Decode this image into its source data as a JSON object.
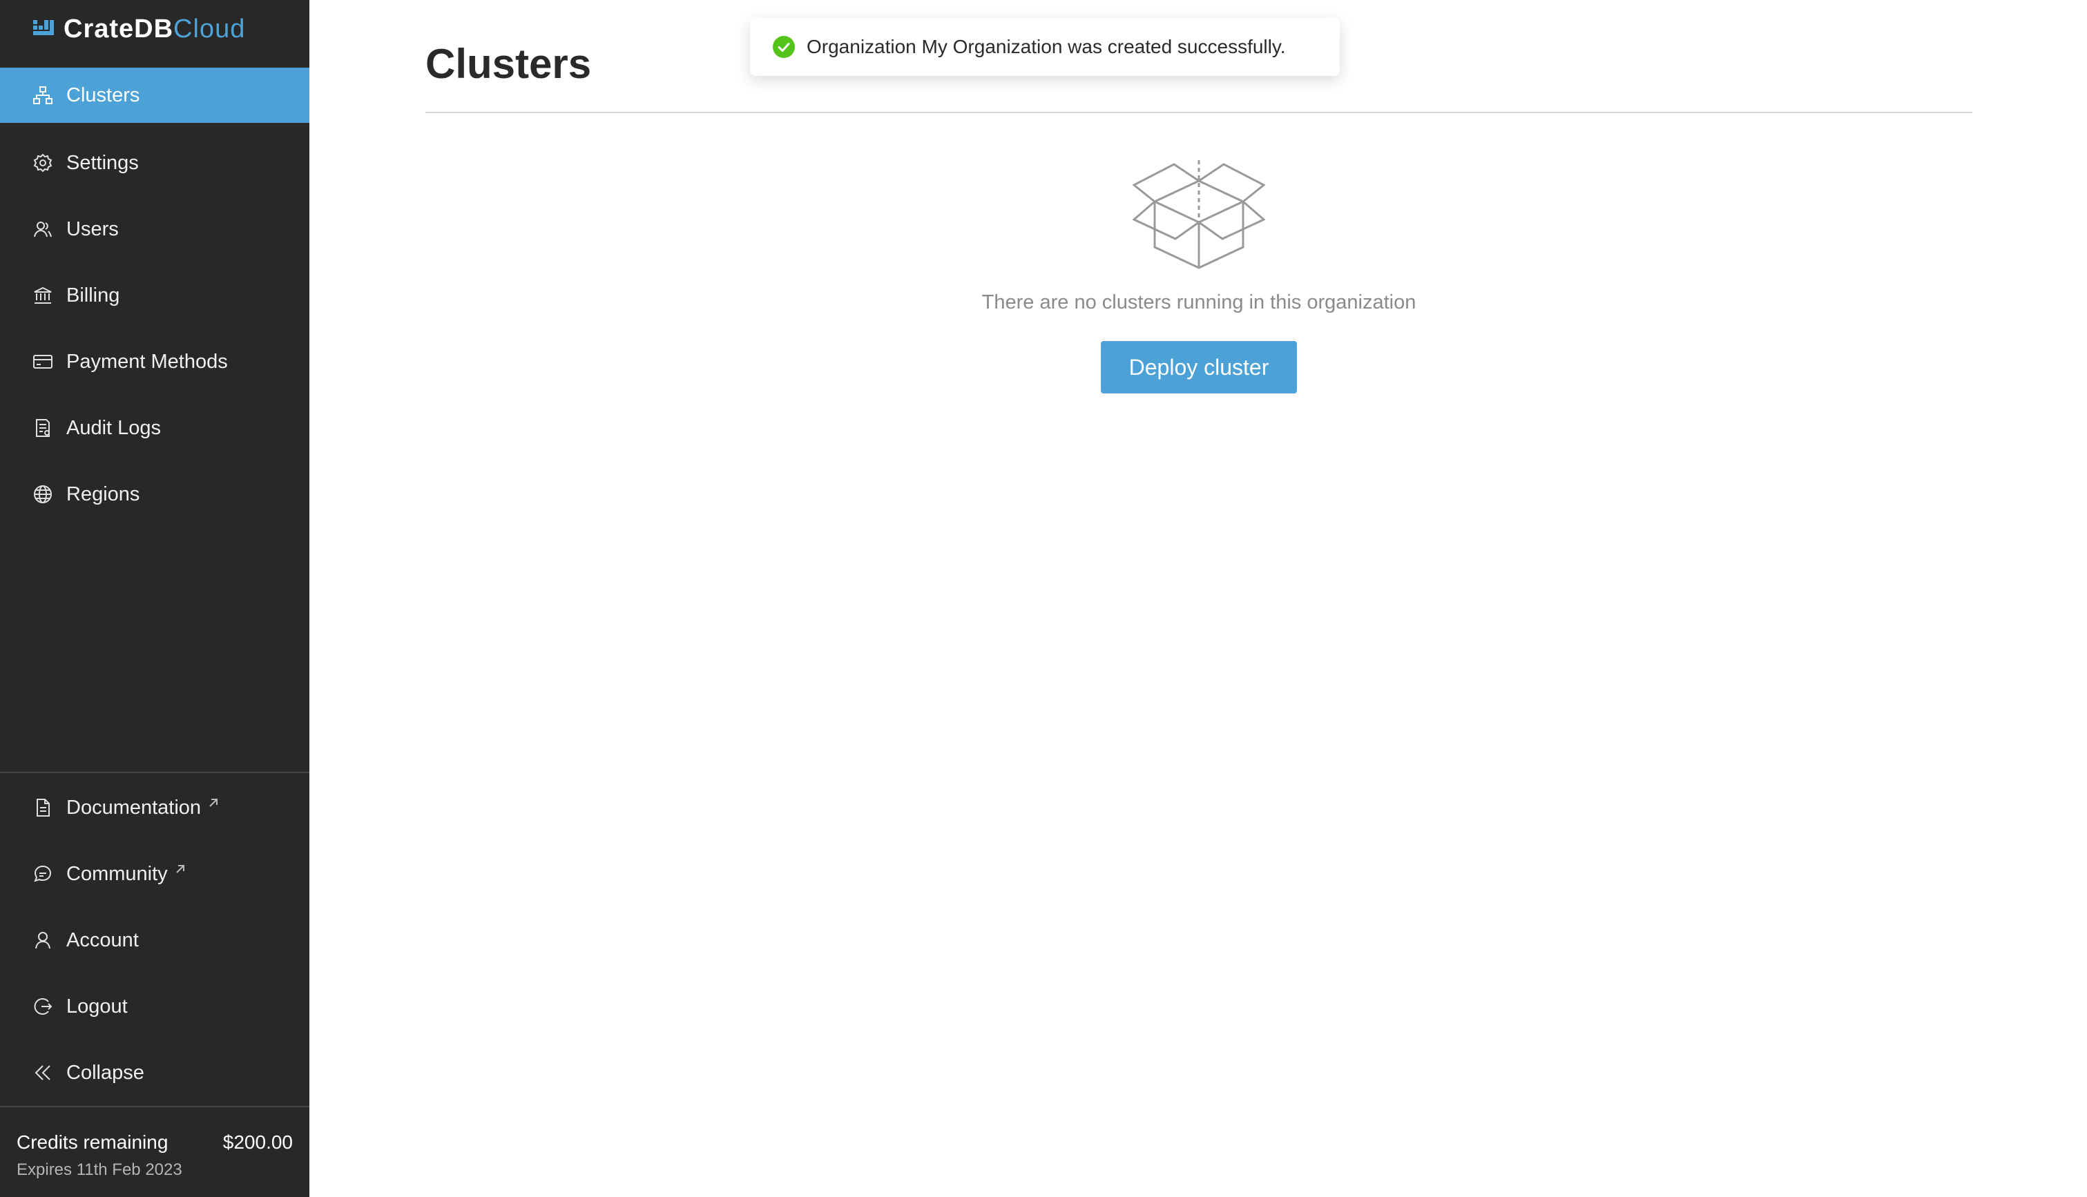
{
  "app": {
    "logo_left": "CrateDB",
    "logo_right": "Cloud",
    "accent_color": "#4ca2d6",
    "sidebar_bg": "#282828"
  },
  "sidebar": {
    "items": [
      {
        "label": "Clusters",
        "icon": "clusters-icon",
        "active": true
      },
      {
        "label": "Settings",
        "icon": "gear-icon"
      },
      {
        "label": "Users",
        "icon": "users-icon"
      },
      {
        "label": "Billing",
        "icon": "bank-icon"
      },
      {
        "label": "Payment Methods",
        "icon": "credit-card-icon"
      },
      {
        "label": "Audit Logs",
        "icon": "audit-log-icon"
      },
      {
        "label": "Regions",
        "icon": "globe-icon"
      }
    ],
    "bottom_items": [
      {
        "label": "Documentation",
        "icon": "document-icon",
        "external": true
      },
      {
        "label": "Community",
        "icon": "chat-icon",
        "external": true
      },
      {
        "label": "Account",
        "icon": "user-icon"
      },
      {
        "label": "Logout",
        "icon": "logout-icon"
      },
      {
        "label": "Collapse",
        "icon": "chevrons-left-icon"
      }
    ],
    "credits": {
      "label": "Credits remaining",
      "amount": "$200.00",
      "expiry": "Expires 11th Feb 2023"
    }
  },
  "main": {
    "title": "Clusters",
    "empty_state": {
      "icon": "open-box-icon",
      "message": "There are no clusters running in this organization",
      "button_label": "Deploy cluster"
    }
  },
  "toast": {
    "message": "Organization My Organization was created successfully.",
    "icon": "check-circle-icon",
    "status_color": "#52c41a"
  }
}
